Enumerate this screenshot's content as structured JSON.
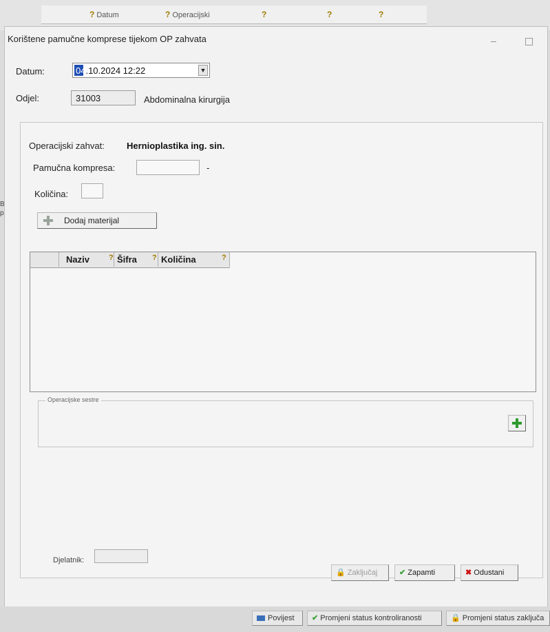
{
  "background": {
    "tabs": [
      "Datum",
      "Operacijski",
      "",
      ""
    ],
    "left_strip": [
      "Br",
      "pri"
    ]
  },
  "dialog": {
    "title": "Korištene pamučne komprese tijekom OP zahvata",
    "datum_label": "Datum:",
    "datum_day_selected": "04",
    "datum_rest": ".10.2024 12:22",
    "odjel_label": "Odjel:",
    "odjel_code": "31003",
    "odjel_name": "Abdominalna kirurgija",
    "operacijski_zahvat_label": "Operacijski zahvat:",
    "operacijski_zahvat_value": "Hernioplastika ing. sin.",
    "pamucna_kompresa_label": "Pamučna kompresa:",
    "pamucna_kompresa_value": "",
    "pamucna_kompresa_suffix": "-",
    "kolicina_label": "Količina:",
    "kolicina_value": "",
    "dodaj_materijal_label": "Dodaj materijal",
    "grid_columns": [
      "Naziv",
      "Šifra",
      "Količina"
    ],
    "operacijske_sestre_label": "Operacijske sestre",
    "djelatnik_label": "Djelatnik:",
    "djelatnik_value": "",
    "zakljucaj_label": "Zaključaj",
    "zapamti_label": "Zapamti",
    "odustani_label": "Odustani"
  },
  "statusbar": {
    "povijest_label": "Povijest",
    "kontrol_label": "Promjeni status kontroliranosti",
    "zaklj_label": "Promjeni status zaključa"
  },
  "colors": {
    "selection": "#1f4fb4",
    "check_green": "#3aa33a",
    "cancel_red": "#cc1111"
  }
}
